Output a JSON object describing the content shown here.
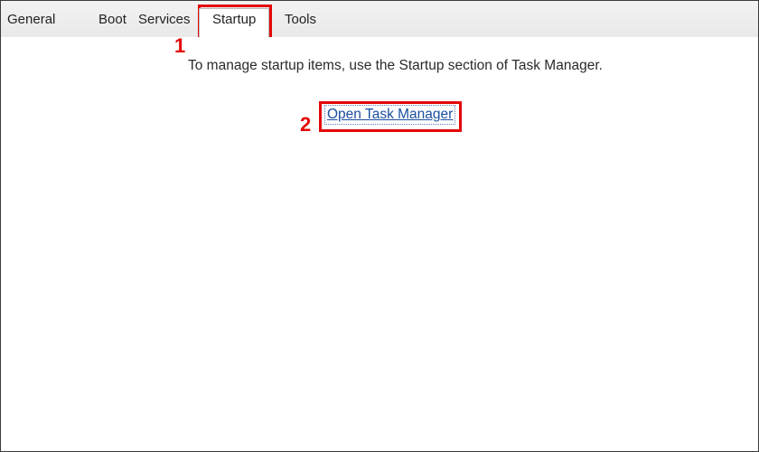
{
  "tabs": {
    "general": {
      "label": "General"
    },
    "boot": {
      "label": "Boot"
    },
    "services": {
      "label": "Services"
    },
    "startup": {
      "label": "Startup"
    },
    "tools": {
      "label": "Tools"
    }
  },
  "content": {
    "help_text": "To manage startup items, use the Startup section of Task Manager.",
    "link_label": "Open Task Manager"
  },
  "annotations": {
    "n1": "1",
    "n2": "2"
  }
}
